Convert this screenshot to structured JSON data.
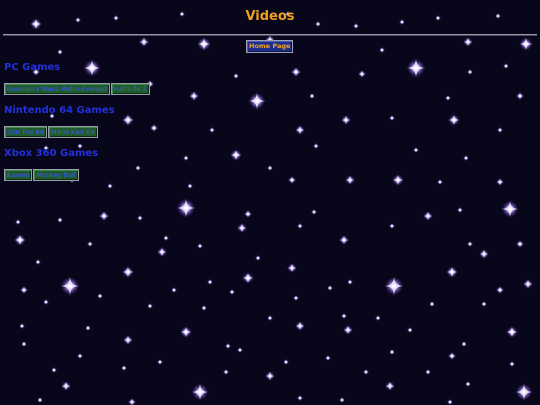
{
  "page": {
    "title": "Videos",
    "home_button": "Home Page"
  },
  "colors": {
    "background": "#08061a",
    "title": "#f0a020",
    "heading": "#2230e0",
    "button_green": "#205a2a",
    "button_blue": "#1d2d8a",
    "button_text_blue": "#3a5cff",
    "star_glow": "#a78bfa"
  },
  "sections": [
    {
      "heading": "PC Games",
      "items": [
        "Geometry Wars: Retro Evolved",
        "Half-Life 2"
      ]
    },
    {
      "heading": "Nintendo 64 Games",
      "items": [
        "Star Fox 64",
        "Mario Kart 64"
      ]
    },
    {
      "heading": "Xbox 360 Games",
      "items": [
        "Kameo",
        "Monkey Ball"
      ]
    }
  ]
}
